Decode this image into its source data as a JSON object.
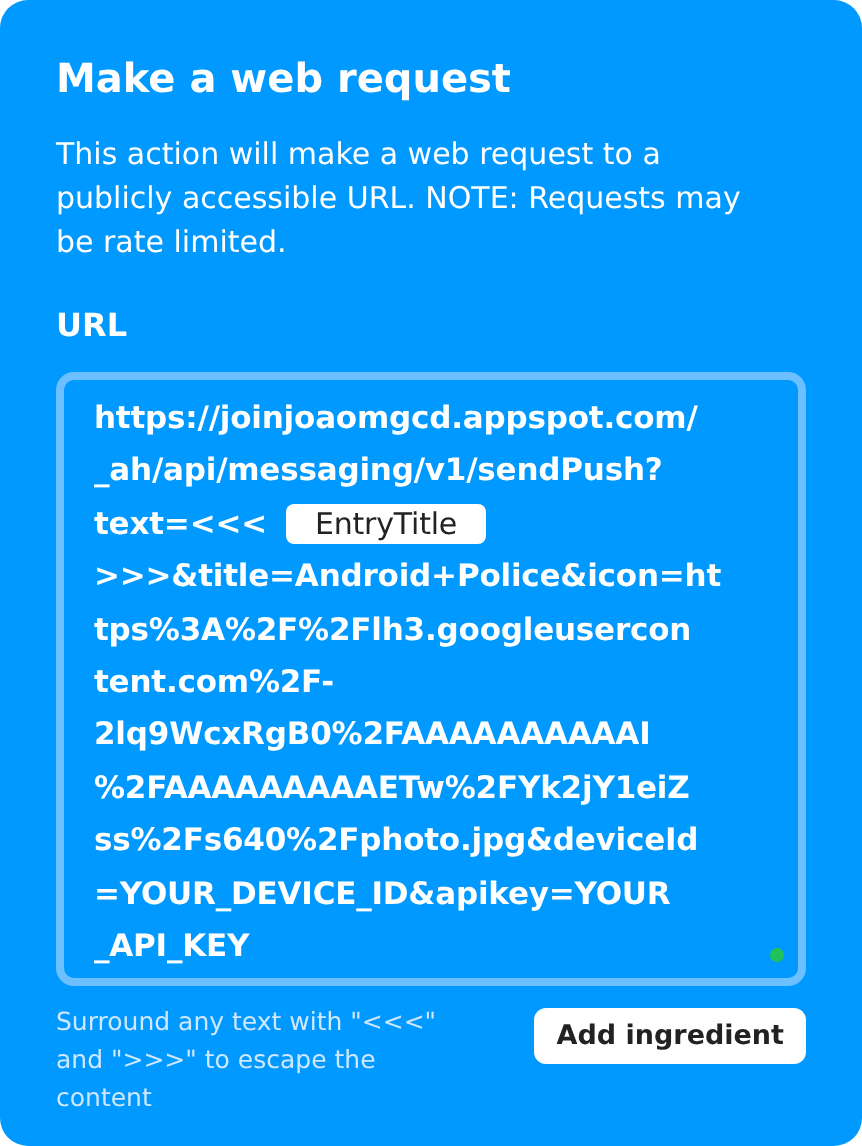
{
  "title": "Make a web request",
  "description": "This action will make a web request to a publicly accessible URL. NOTE: Requests may be rate limited.",
  "url_field": {
    "label": "URL",
    "focused": true,
    "lines": [
      [
        {
          "kind": "text",
          "text": "https://joinjoaomgcd.appspot.com/"
        }
      ],
      [
        {
          "kind": "text",
          "text": "_ah/api/messaging/v1/sendPush?"
        }
      ],
      [
        {
          "kind": "text",
          "text": "text=<<<"
        },
        {
          "kind": "ingredient",
          "text": "EntryTitle"
        }
      ],
      [
        {
          "kind": "text",
          "text": ">>>&title=Android+Police&icon=ht"
        }
      ],
      [
        {
          "kind": "text",
          "text": "tps%3A%2F%2Flh3.googleusercon"
        }
      ],
      [
        {
          "kind": "text",
          "text": "tent.com%2F-"
        }
      ],
      [
        {
          "kind": "text",
          "text": "2lq9WcxRgB0%2FAAAAAAAAAAI"
        }
      ],
      [
        {
          "kind": "text",
          "text": "%2FAAAAAAAAAETw%2FYk2jY1eiZ"
        }
      ],
      [
        {
          "kind": "text",
          "text": "ss%2Fs640%2Fphoto.jpg&deviceId"
        }
      ],
      [
        {
          "kind": "text",
          "text": "=YOUR_DEVICE_ID&apikey=YOUR"
        }
      ],
      [
        {
          "kind": "text",
          "text": "_API_KEY"
        }
      ]
    ]
  },
  "helper_text": "Surround any text with \"<<<\" and \">>>\" to escape the content",
  "add_button": "Add ingredient"
}
